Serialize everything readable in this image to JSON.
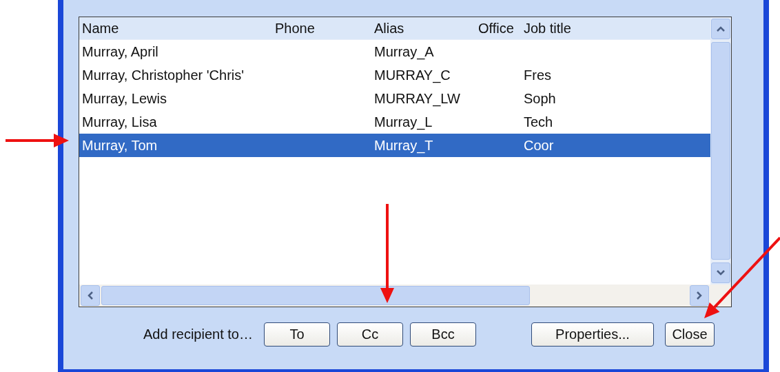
{
  "list": {
    "columns": [
      "Name",
      "Phone",
      "Alias",
      "Office",
      "Job title"
    ],
    "rows": [
      {
        "name": "Murray, April",
        "alias": "Murray_A",
        "job_title": "",
        "selected": false
      },
      {
        "name": "Murray, Christopher 'Chris'",
        "alias": "MURRAY_C",
        "job_title": "Fres",
        "selected": false
      },
      {
        "name": "Murray, Lewis",
        "alias": "MURRAY_LW",
        "job_title": "Soph",
        "selected": false
      },
      {
        "name": "Murray, Lisa",
        "alias": "Murray_L",
        "job_title": "Tech",
        "selected": false
      },
      {
        "name": "Murray, Tom",
        "alias": "Murray_T",
        "job_title": "Coor",
        "selected": true
      }
    ]
  },
  "footer": {
    "label": "Add recipient to…",
    "recipient_buttons": [
      "To",
      "Cc",
      "Bcc"
    ],
    "properties_button": "Properties...",
    "close_button": "Close"
  }
}
